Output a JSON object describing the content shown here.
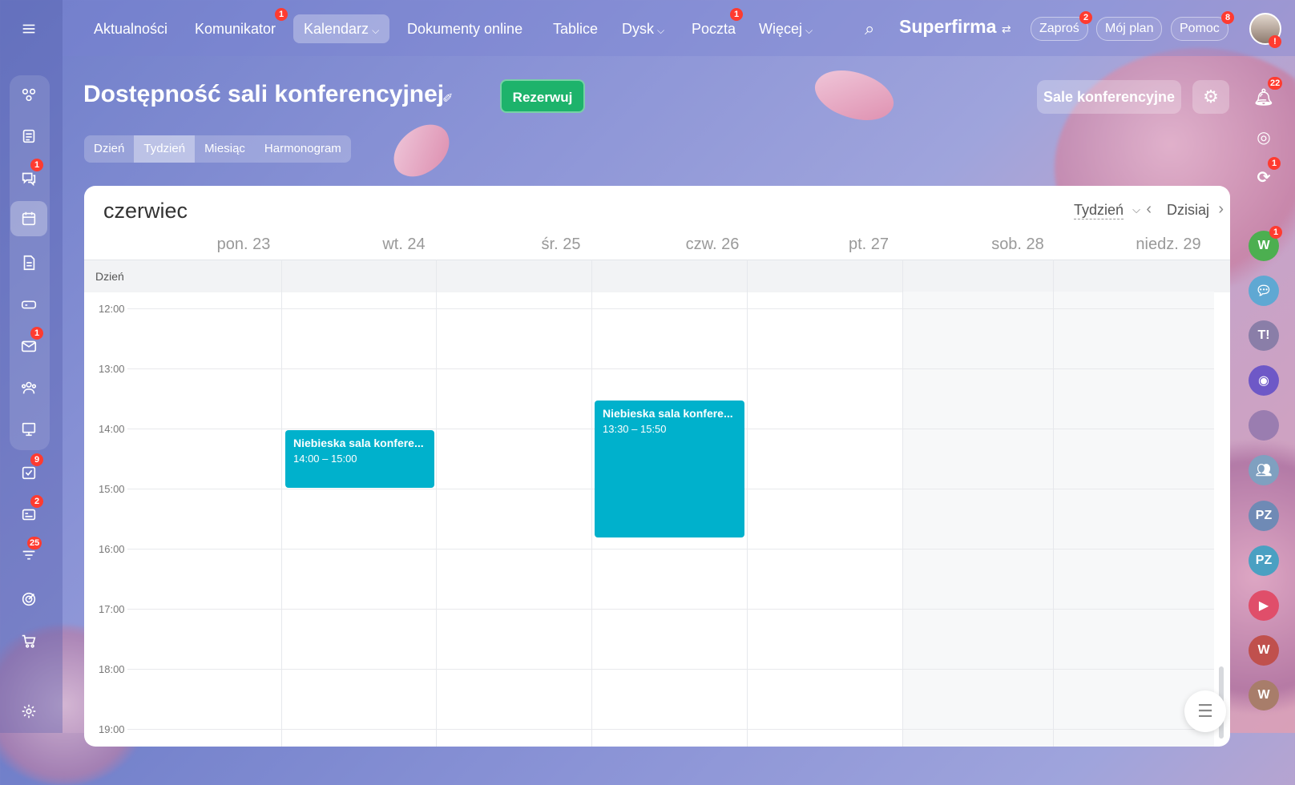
{
  "nav": {
    "items": [
      {
        "label": "Aktualności"
      },
      {
        "label": "Komunikator",
        "badge": "1"
      },
      {
        "label": "Kalendarz",
        "active": true
      },
      {
        "label": "Dokumenty online"
      },
      {
        "label": "Tablice"
      },
      {
        "label": "Dysk"
      },
      {
        "label": "Poczta",
        "badge": "1"
      },
      {
        "label": "Więcej"
      }
    ],
    "brand": "Superfirma",
    "invite": {
      "label": "Zaproś",
      "badge": "2"
    },
    "plan": {
      "label": "Mój plan"
    },
    "help": {
      "label": "Pomoc",
      "badge": "8"
    }
  },
  "left_sidebar": {
    "badges": {
      "messages": "1",
      "mail": "1",
      "tasks": "9",
      "crm": "2",
      "sales": "25"
    }
  },
  "header": {
    "title": "Dostępność sali konferencyjnej",
    "reserve_label": "Rezerwuj",
    "rooms_label": "Sale konferencyjne",
    "view_tabs": [
      "Dzień",
      "Tydzień",
      "Miesiąc",
      "Harmonogram"
    ],
    "active_tab": "Tydzień"
  },
  "calendar": {
    "month": "czerwiec",
    "view_select": "Tydzień",
    "today_label": "Dzisiaj",
    "allday_label": "Dzień",
    "days": [
      {
        "label": "pon. 23"
      },
      {
        "label": "wt. 24"
      },
      {
        "label": "śr. 25"
      },
      {
        "label": "czw. 26"
      },
      {
        "label": "pt. 27"
      },
      {
        "label": "sob. 28"
      },
      {
        "label": "niedz. 29"
      }
    ],
    "hours": [
      "12:00",
      "13:00",
      "14:00",
      "15:00",
      "16:00",
      "17:00",
      "18:00",
      "19:00"
    ],
    "events": [
      {
        "title": "Niebieska sala konfere...",
        "time": "14:00 – 15:00"
      },
      {
        "title": "Niebieska sala konfere...",
        "time": "13:30 – 15:50"
      }
    ]
  },
  "right_sidebar": {
    "notifications_badge": "22",
    "sync_badge": "1",
    "chats": [
      {
        "initials": "W",
        "badge": "1",
        "color": "#4caf50"
      },
      {
        "initials": "PZ",
        "color": "#6f8ab5"
      },
      {
        "initials": "PZ",
        "color": "#4aa0c2"
      },
      {
        "initials": "W",
        "color": "#c0504d"
      },
      {
        "initials": "W",
        "color": "#a87d6a"
      }
    ]
  },
  "colors": {
    "accent": "#00b1cc",
    "reserve": "#1db36b",
    "badge": "#ff3b30"
  }
}
